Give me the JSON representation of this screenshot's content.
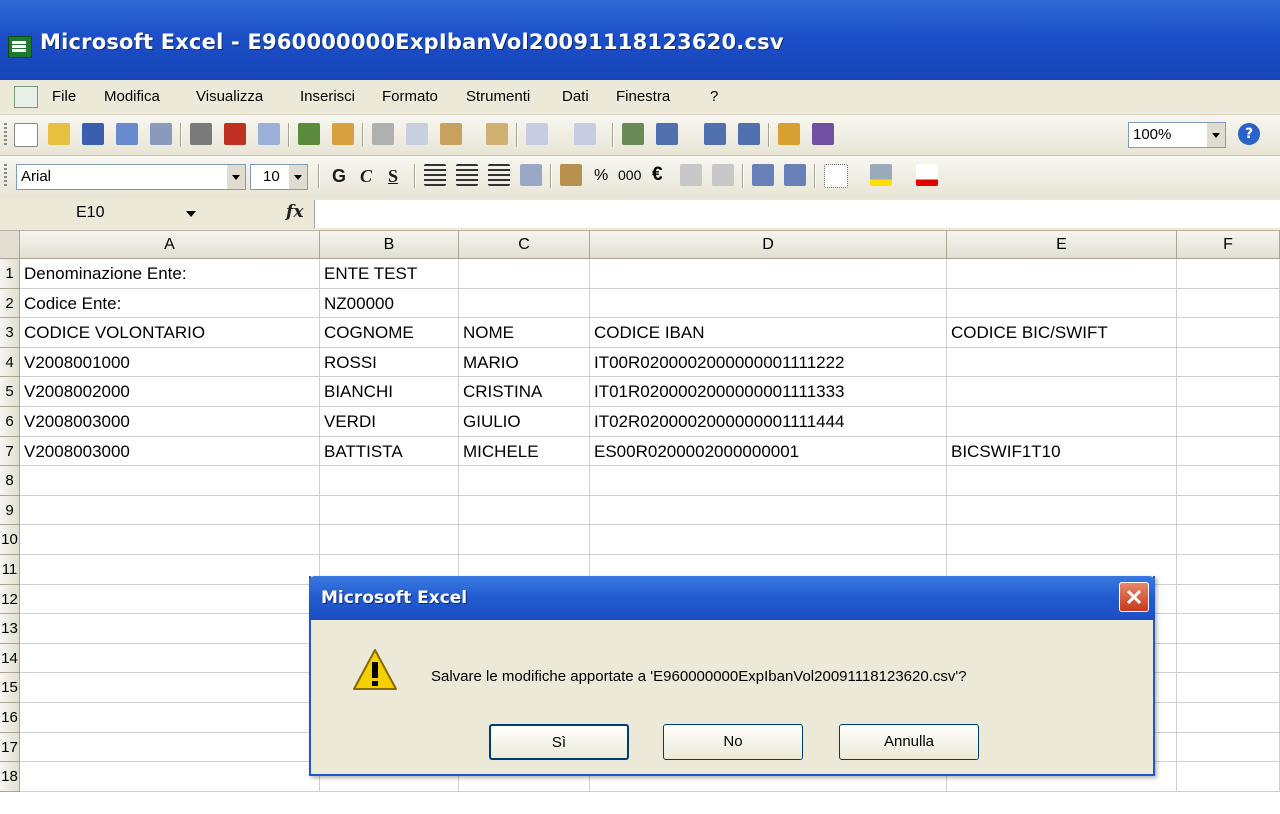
{
  "window": {
    "title": "Microsoft Excel - E960000000ExpIbanVol20091118123620.csv"
  },
  "menu": {
    "items": [
      "File",
      "Modifica",
      "Visualizza",
      "Inserisci",
      "Formato",
      "Strumenti",
      "Dati",
      "Finestra",
      "?"
    ]
  },
  "toolbar": {
    "zoom": "100%"
  },
  "format_toolbar": {
    "font": "Arial",
    "size": "10",
    "bold": "G",
    "italic": "C",
    "underline": "S",
    "percent": "%",
    "thousands": "000",
    "euro": "€"
  },
  "formula_bar": {
    "name_box": "E10",
    "fx": "fx",
    "formula": ""
  },
  "sheet": {
    "columns": [
      "A",
      "B",
      "C",
      "D",
      "E",
      "F"
    ],
    "row_numbers": [
      "1",
      "2",
      "3",
      "4",
      "5",
      "6",
      "7",
      "8",
      "9",
      "10",
      "11",
      "12",
      "13",
      "14",
      "15",
      "16",
      "17",
      "18"
    ],
    "rows": [
      [
        "Denominazione Ente:",
        "ENTE TEST",
        "",
        "",
        "",
        ""
      ],
      [
        "Codice Ente:",
        "NZ00000",
        "",
        "",
        "",
        ""
      ],
      [
        "CODICE VOLONTARIO",
        "COGNOME",
        "NOME",
        "CODICE IBAN",
        "CODICE BIC/SWIFT",
        ""
      ],
      [
        "V2008001000",
        "ROSSI",
        "MARIO",
        "IT00R0200002000000001111222",
        "",
        ""
      ],
      [
        "V2008002000",
        "BIANCHI",
        "CRISTINA",
        "IT01R0200002000000001111333",
        "",
        ""
      ],
      [
        "V2008003000",
        "VERDI",
        "GIULIO",
        "IT02R0200002000000001111444",
        "",
        ""
      ],
      [
        "V2008003000",
        "BATTISTA",
        "MICHELE",
        "ES00R0200002000000001",
        "BICSWIF1T10",
        ""
      ]
    ]
  },
  "dialog": {
    "title": "Microsoft Excel",
    "message": "Salvare le modifiche apportate a 'E960000000ExpIbanVol20091118123620.csv'?",
    "buttons": {
      "yes": "Sì",
      "no": "No",
      "cancel": "Annulla"
    }
  }
}
